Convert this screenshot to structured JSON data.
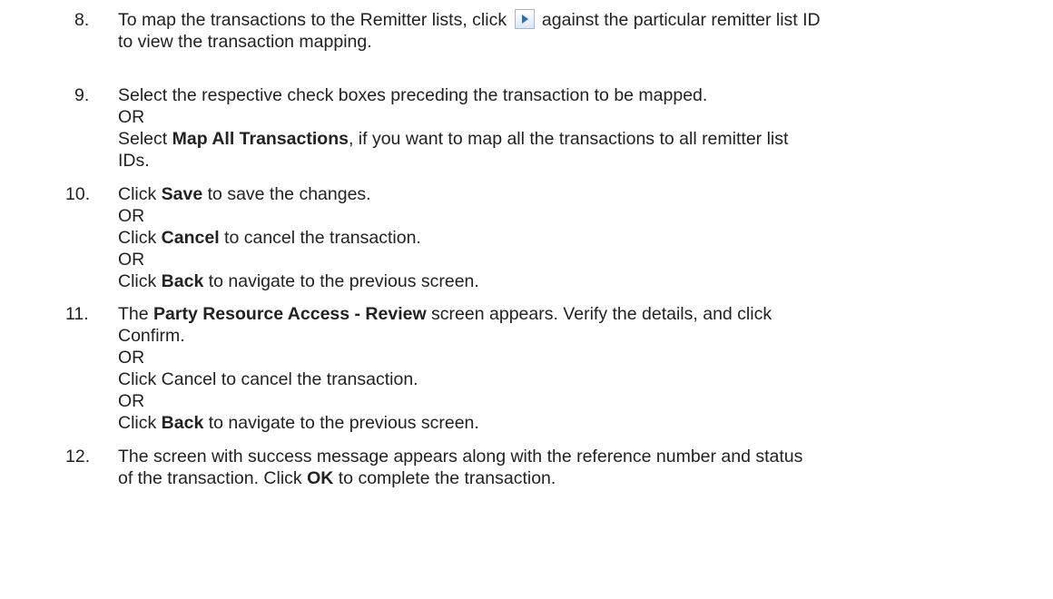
{
  "steps": [
    {
      "number": "8.",
      "lines": [
        {
          "before": "To map the transactions to the Remitter lists, click",
          "icon": "expand-arrow-icon",
          "after": "against the particular remitter list ID"
        },
        {
          "text": "to view the transaction mapping."
        }
      ]
    },
    {
      "number": "9.",
      "lines": [
        {
          "text": "Select the respective check boxes preceding the transaction to be mapped."
        },
        {
          "text": "OR"
        },
        {
          "pre": "Select ",
          "bold": "Map All Transactions",
          "post": ", if you want to map all the transactions to all remitter list"
        },
        {
          "text": "IDs."
        }
      ]
    },
    {
      "number": "10.",
      "lines": [
        {
          "pre": "Click ",
          "bold": "Save",
          "post": " to save the changes."
        },
        {
          "text": "OR"
        },
        {
          "pre": "Click ",
          "bold": "Cancel",
          "post": " to cancel the transaction."
        },
        {
          "text": "OR"
        },
        {
          "pre": "Click ",
          "bold": "Back",
          "post": " to navigate to the previous screen."
        }
      ]
    },
    {
      "number": "11.",
      "lines": [
        {
          "pre": "The ",
          "bold": "Party Resource Access - Review",
          "post": " screen appears. Verify the details, and click"
        },
        {
          "text": "Confirm."
        },
        {
          "text": "OR"
        },
        {
          "text": "Click Cancel to cancel the transaction."
        },
        {
          "text": "OR"
        },
        {
          "pre": "Click ",
          "bold": "Back",
          "post": " to navigate to the previous screen."
        }
      ]
    },
    {
      "number": "12.",
      "lines": [
        {
          "text": "The screen with success message appears along with the reference number and status"
        },
        {
          "pre": "of the transaction. Click ",
          "bold": "OK",
          "post": " to complete the transaction."
        }
      ]
    }
  ]
}
